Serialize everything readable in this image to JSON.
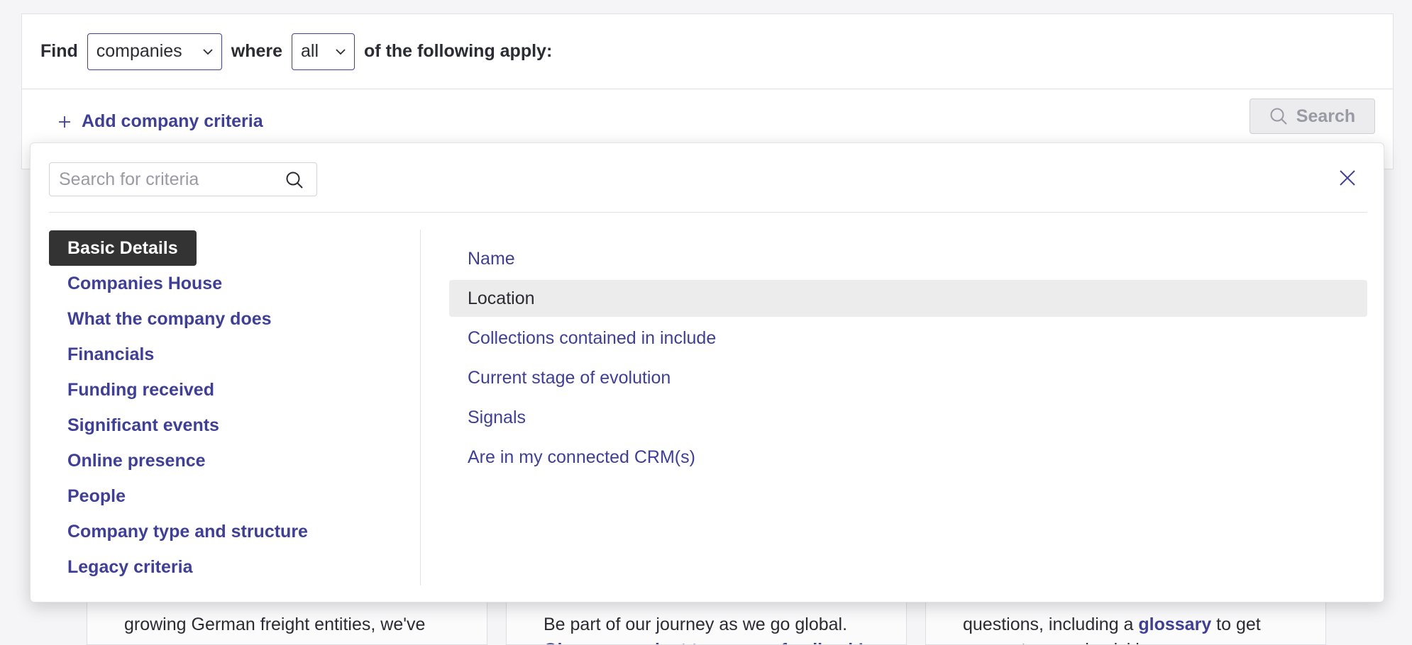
{
  "query": {
    "find_label": "Find",
    "entity_select": "companies",
    "where_label": "where",
    "match_select": "all",
    "suffix": "of the following apply:"
  },
  "toolbar": {
    "add_criteria_label": "Add company criteria",
    "search_label": "Search"
  },
  "dropdown": {
    "search_placeholder": "Search for criteria",
    "categories": [
      "Basic Details",
      "Companies House",
      "What the company does",
      "Financials",
      "Funding received",
      "Significant events",
      "Online presence",
      "People",
      "Company type and structure",
      "Legacy criteria"
    ],
    "active_category": "Basic Details",
    "options": [
      "Name",
      "Location",
      "Collections contained in include",
      "Current stage of evolution",
      "Signals",
      "Are in my connected CRM(s)"
    ],
    "highlighted_option": "Location"
  },
  "background_cards": [
    {
      "line1": "growing German freight entities, we've",
      "line2": ""
    },
    {
      "line1": "Be part of our journey as we go global.",
      "link": "Give our product team your feedback!"
    },
    {
      "line1_pre": "questions, including a ",
      "line1_link": "glossary",
      "line1_post": " to get",
      "line2": "you up to speed quickly."
    }
  ],
  "colors": {
    "accent": "#3f3f96",
    "active_bg": "#333333",
    "highlight_bg": "#ececec"
  }
}
